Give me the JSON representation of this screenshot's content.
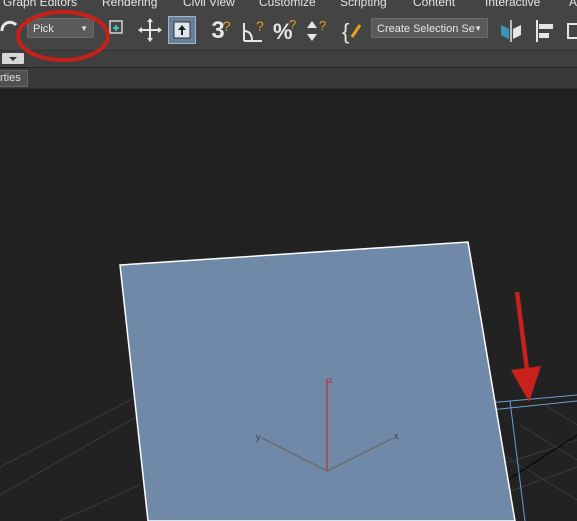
{
  "menu": {
    "items": [
      "Graph Editors",
      "Rendering",
      "Civil View",
      "Customize",
      "Scripting",
      "Content",
      "Interactive",
      "A"
    ]
  },
  "toolbar": {
    "selection_filter": "Pick",
    "named_selection_set": "Create Selection Se",
    "snap_label": "3"
  },
  "tabs": {
    "properties": "rties"
  },
  "viewport": {
    "axis_labels": {
      "z": "z",
      "x": "x",
      "y": "y"
    },
    "colors": {
      "plane_fill": "#7089a8",
      "plane_edge": "#ffffff",
      "selected_outline": "#6d9fd6",
      "z_axis": "#b8323a",
      "grid": "#3c3c3c",
      "annotation_red": "#c8201a"
    }
  },
  "icons": [
    "move-icon",
    "select-object-icon",
    "snap-3d-icon",
    "angle-snap-icon",
    "percent-snap-icon",
    "spinner-snap-icon",
    "edit-named-selection-icon",
    "mirror-icon",
    "align-icon"
  ]
}
